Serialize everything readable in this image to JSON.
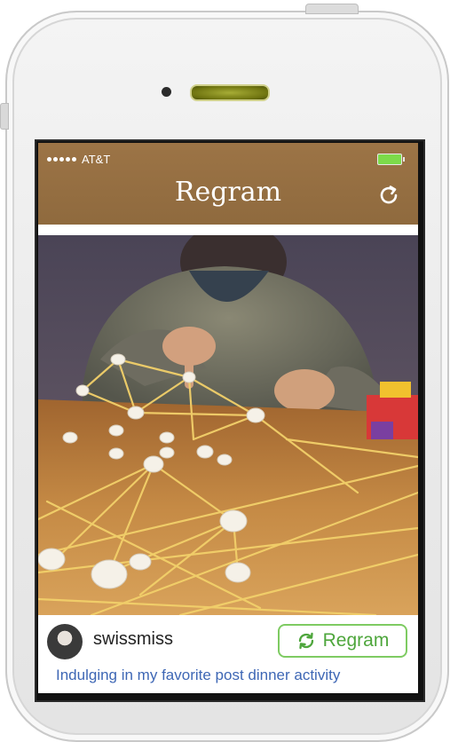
{
  "status_bar": {
    "carrier": "AT&T",
    "signal_bars": 5,
    "battery_level": 1.0,
    "battery_color": "#7cdb4a"
  },
  "nav_bar": {
    "title": "Regram",
    "background_color": "#9c7446",
    "refresh_icon": "refresh-icon"
  },
  "post": {
    "photo_description_icon": "photo",
    "username": "swissmiss",
    "regram_button_label": "Regram",
    "regram_icon": "repost-icon",
    "accent_color": "#4ea63c",
    "caption": "Indulging in my favorite post dinner activity",
    "caption_color": "#3e67b5"
  }
}
